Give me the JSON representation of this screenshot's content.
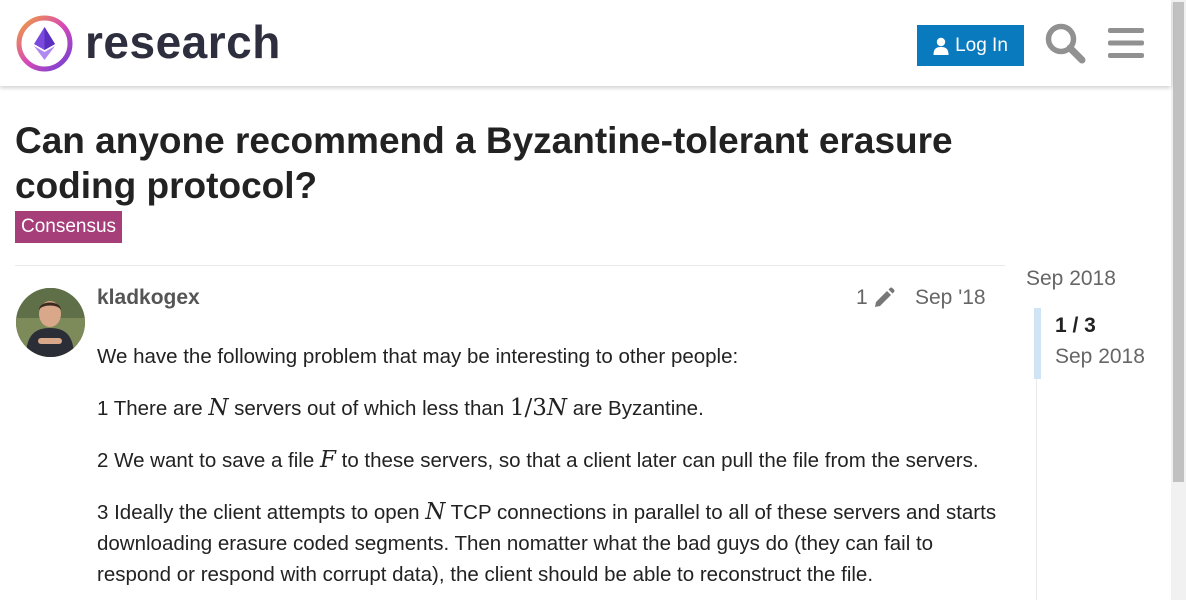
{
  "header": {
    "site_name": "research",
    "login_label": "Log In",
    "logo_colors": [
      "#6b3fd6",
      "#f08a2c",
      "#d94ab5"
    ]
  },
  "topic": {
    "title": "Can anyone recommend a Byzantine-tolerant erasure coding protocol?",
    "category": "Consensus",
    "category_color": "#a63e7a"
  },
  "post": {
    "username": "kladkogex",
    "edit_count": "1",
    "date": "Sep '18",
    "intro": "We have the following problem that may be interesting to other people:",
    "p1": {
      "a": "1 There are ",
      "n": "N",
      "b": " servers out of which less than ",
      "frac": "1/3",
      "n2": "N",
      "c": " are Byzantine."
    },
    "p2": {
      "a": "2 We want to save a file ",
      "f": "F",
      "b": " to these servers, so that a client later can pull the file from the servers."
    },
    "p3": {
      "a": "3 Ideally the client attempts to open ",
      "n": "N",
      "b": " TCP connections in parallel to all of these servers and starts downloading erasure coded segments. Then nomatter what the bad guys do (they can fail to respond or respond with corrupt data), the client should be able to reconstruct the file."
    }
  },
  "timeline": {
    "top_date": "Sep 2018",
    "progress": "1 / 3",
    "current_date": "Sep 2018",
    "accent_color": "#cfe5f5"
  }
}
